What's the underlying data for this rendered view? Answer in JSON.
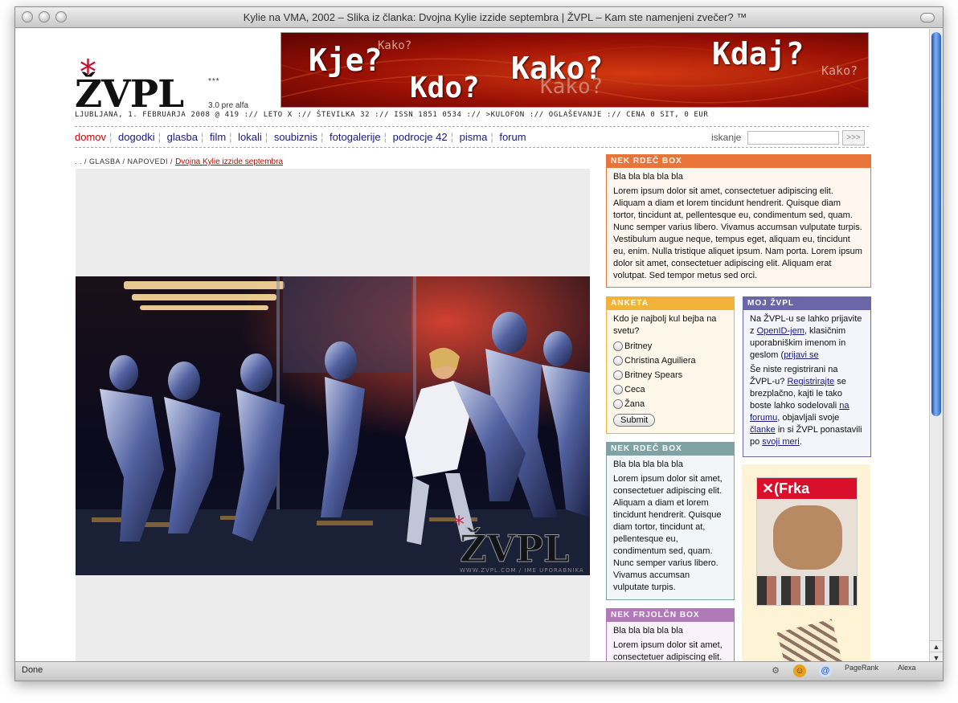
{
  "window": {
    "title": "Kylie na VMA, 2002 – Slika iz članka: Dvojna Kylie izzide septembra | ŽVPL – Kam ste namenjeni zvečer? ™"
  },
  "statusbar": {
    "status": "Done",
    "pagerank_label": "PageRank",
    "alexa_label": "Alexa"
  },
  "site": {
    "logo_star": "*",
    "logo": "ŽVPL",
    "logo_stars": "***",
    "version": "3.0 pre alfa",
    "infoline": "LJUBLJANA, 1. FEBRUARJA 2008 @ 419 :// LETO X :// ŠTEVILKA 32 :// ISSN 1851 0534 :// >KULOFON :// OGLAŠEVANJE :// CENA 0 SIT, 0 EUR"
  },
  "banner": {
    "kje": "Kje?",
    "kako": "Kako?",
    "kdo": "Kdo?",
    "kdaj": "Kdaj?",
    "small_kako": "Kako?"
  },
  "nav": {
    "items": [
      {
        "label": "domov",
        "active": true
      },
      {
        "label": "dogodki"
      },
      {
        "label": "glasba"
      },
      {
        "label": "film"
      },
      {
        "label": "lokali"
      },
      {
        "label": "soubiznis"
      },
      {
        "label": "fotogalerije"
      },
      {
        "label": "podrocje 42"
      },
      {
        "label": "pisma"
      },
      {
        "label": "forum"
      }
    ]
  },
  "search": {
    "label": "iskanje",
    "button": ">>>"
  },
  "breadcrumb": {
    "prefix": ". . / GLASBA / NAPOVEDI /",
    "current": "Dvojna Kylie izzide septembra"
  },
  "photo": {
    "watermark": "ŽVPL",
    "watermark_sub": "WWW.ZVPL.COM / IME UPORABNIKA"
  },
  "box_rdec_top": {
    "header": "NEK RDEČ BOX",
    "title": "Bla bla bla bla bla",
    "text": "Lorem ipsum dolor sit amet, consectetuer adipiscing elit. Aliquam a diam et lorem tincidunt hendrerit. Quisque diam tortor, tincidunt at, pellentesque eu, condimentum sed, quam. Nunc semper varius libero. Vivamus accumsan vulputate turpis. Vestibulum augue neque, tempus eget, aliquam eu, tincidunt eu, enim. Nulla tristique aliquet ipsum. Nam porta. Lorem ipsum dolor sit amet, consectetuer adipiscing elit. Aliquam erat volutpat. Sed tempor metus sed orci."
  },
  "anketa": {
    "header": "ANKETA",
    "question": "Kdo je najbolj kul bejba na svetu?",
    "options": [
      "Britney",
      "Christina Aguiliera",
      "Britney Spears",
      "Ceca",
      "Žana"
    ],
    "submit": "Submit"
  },
  "moj": {
    "header": "MOJ ŽVPL",
    "p1_a": "Na ŽVPL-u se lahko prijavite z ",
    "p1_link1": "OpenID-jem",
    "p1_b": ", klasičnim uporabniškim imenom in geslom (",
    "p1_link2": "prijavi se",
    "p2_a": "Še niste registrirani na ŽVPL-u? ",
    "p2_link1": "Registrirajte",
    "p2_b": " se brezplačno, kajti le tako boste lahko sodelovali ",
    "p2_link2": "na forumu",
    "p2_c": ", objavljali svoje ",
    "p2_link3": "članke",
    "p2_d": " in si ŽVPL ponastavili po ",
    "p2_link4": "svoji meri",
    "p2_e": "."
  },
  "box_rdec_mid": {
    "header": "NEK RDEČ BOX",
    "title": "Bla bla bla bla bla",
    "text": "Lorem ipsum dolor sit amet, consectetuer adipiscing elit. Aliquam a diam et lorem tincidunt hendrerit. Quisque diam tortor, tincidunt at, pellentesque eu, condimentum sed, quam. Nunc semper varius libero. Vivamus accumsan vulputate turpis."
  },
  "box_frjol": {
    "header": "NEK FRJOLČN BOX",
    "title": "Bla bla bla bla bla",
    "text": "Lorem ipsum dolor sit amet, consectetuer adipiscing elit."
  },
  "ad": {
    "magazine": "Frka"
  },
  "colors": {
    "accent_red": "#c0102f",
    "box_orange": "#e8743a",
    "box_yellow": "#f1b23a",
    "box_purple": "#6b66a8",
    "box_teal": "#7fa3a3",
    "box_pink": "#b07ab6"
  }
}
